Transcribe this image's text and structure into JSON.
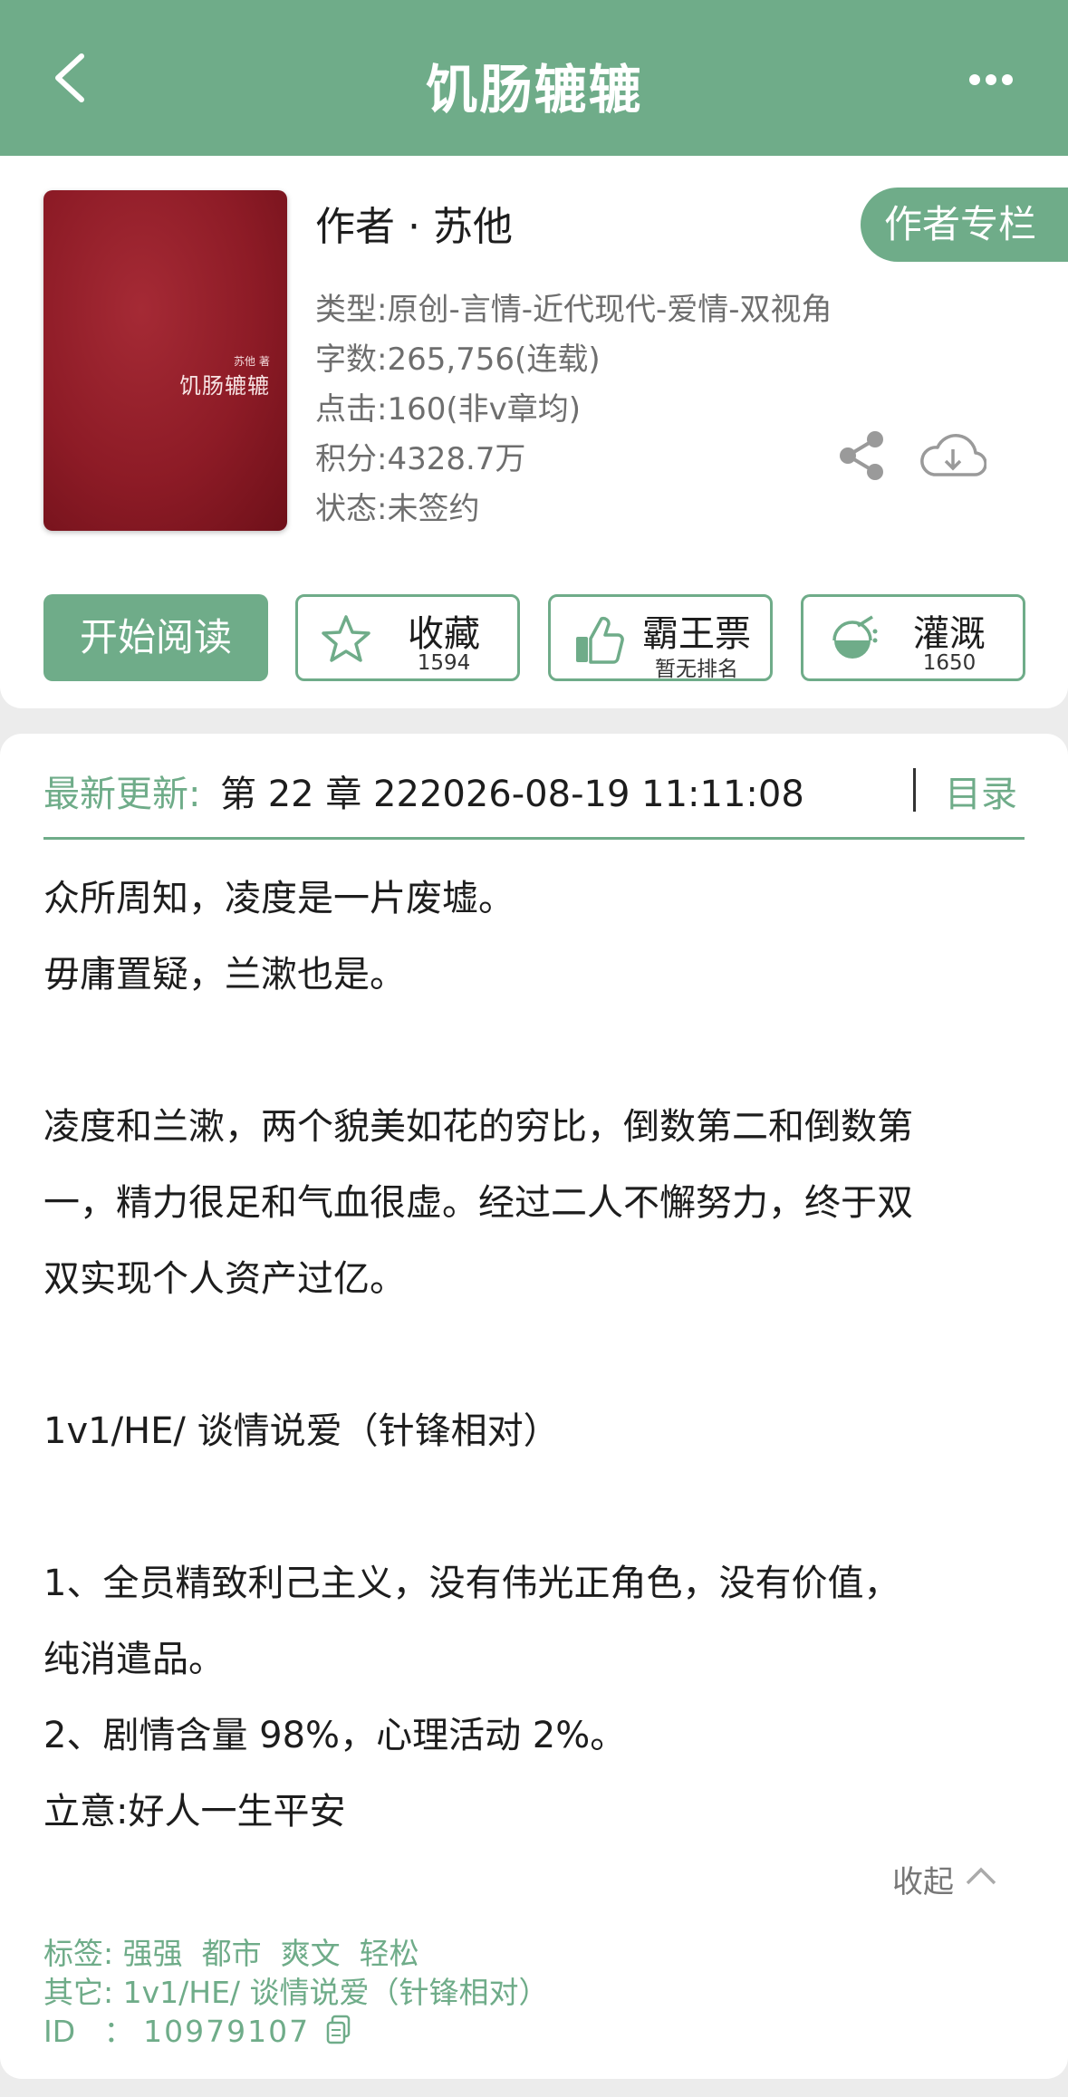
{
  "header": {
    "title": "饥肠辘辘"
  },
  "book": {
    "cover_author": "苏他 著",
    "cover_title": "饥肠辘辘",
    "author_line": "作者 · 苏他",
    "author_button": "作者专栏",
    "meta": [
      "类型:原创-言情-近代现代-爱情-双视角",
      "字数:265,756(连载)",
      "点击:160(非v章均)",
      "积分:4328.7万",
      "状态:未签约"
    ]
  },
  "actions": {
    "read": "开始阅读",
    "collect": {
      "label": "收藏",
      "sub": "1594"
    },
    "vote": {
      "label": "霸王票",
      "sub": "暂无排名"
    },
    "water": {
      "label": "灌溉",
      "sub": "1650"
    }
  },
  "update": {
    "label": "最新更新:",
    "value": "第 22 章 222026-08-19 11:11:08",
    "toc": "目录"
  },
  "intro": [
    "众所周知，凌度是一片废墟。",
    "毋庸置疑，兰漱也是。",
    "",
    "凌度和兰漱，两个貌美如花的穷比，倒数第二和倒数第",
    "一，精力很足和气血很虚。经过二人不懈努力，终于双",
    "双实现个人资产过亿。",
    "",
    "1v1/HE/ 谈情说爱（针锋相对）",
    "",
    "1、全员精致利己主义，没有伟光正角色，没有价值，",
    "纯消遣品。",
    "2、剧情含量 98%，心理活动 2%。",
    "立意:好人一生平安"
  ],
  "collapse": "收起",
  "info": {
    "tags_label": "标签:",
    "tags": "强强  都市  爽文  轻松",
    "other_label": "其它:",
    "other": "1v1/HE/ 谈情说爱（针锋相对）",
    "id_label": "ID   ：",
    "id": "10979107"
  },
  "colors": {
    "accent": "#6fac89",
    "cover": "#8d1b26"
  }
}
